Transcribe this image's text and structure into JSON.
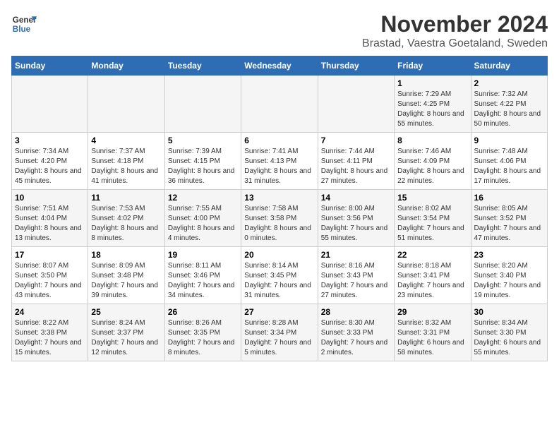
{
  "header": {
    "logo_general": "General",
    "logo_blue": "Blue",
    "month_title": "November 2024",
    "location": "Brastad, Vaestra Goetaland, Sweden"
  },
  "weekdays": [
    "Sunday",
    "Monday",
    "Tuesday",
    "Wednesday",
    "Thursday",
    "Friday",
    "Saturday"
  ],
  "weeks": [
    [
      {
        "day": "",
        "info": ""
      },
      {
        "day": "",
        "info": ""
      },
      {
        "day": "",
        "info": ""
      },
      {
        "day": "",
        "info": ""
      },
      {
        "day": "",
        "info": ""
      },
      {
        "day": "1",
        "info": "Sunrise: 7:29 AM\nSunset: 4:25 PM\nDaylight: 8 hours and 55 minutes."
      },
      {
        "day": "2",
        "info": "Sunrise: 7:32 AM\nSunset: 4:22 PM\nDaylight: 8 hours and 50 minutes."
      }
    ],
    [
      {
        "day": "3",
        "info": "Sunrise: 7:34 AM\nSunset: 4:20 PM\nDaylight: 8 hours and 45 minutes."
      },
      {
        "day": "4",
        "info": "Sunrise: 7:37 AM\nSunset: 4:18 PM\nDaylight: 8 hours and 41 minutes."
      },
      {
        "day": "5",
        "info": "Sunrise: 7:39 AM\nSunset: 4:15 PM\nDaylight: 8 hours and 36 minutes."
      },
      {
        "day": "6",
        "info": "Sunrise: 7:41 AM\nSunset: 4:13 PM\nDaylight: 8 hours and 31 minutes."
      },
      {
        "day": "7",
        "info": "Sunrise: 7:44 AM\nSunset: 4:11 PM\nDaylight: 8 hours and 27 minutes."
      },
      {
        "day": "8",
        "info": "Sunrise: 7:46 AM\nSunset: 4:09 PM\nDaylight: 8 hours and 22 minutes."
      },
      {
        "day": "9",
        "info": "Sunrise: 7:48 AM\nSunset: 4:06 PM\nDaylight: 8 hours and 17 minutes."
      }
    ],
    [
      {
        "day": "10",
        "info": "Sunrise: 7:51 AM\nSunset: 4:04 PM\nDaylight: 8 hours and 13 minutes."
      },
      {
        "day": "11",
        "info": "Sunrise: 7:53 AM\nSunset: 4:02 PM\nDaylight: 8 hours and 8 minutes."
      },
      {
        "day": "12",
        "info": "Sunrise: 7:55 AM\nSunset: 4:00 PM\nDaylight: 8 hours and 4 minutes."
      },
      {
        "day": "13",
        "info": "Sunrise: 7:58 AM\nSunset: 3:58 PM\nDaylight: 8 hours and 0 minutes."
      },
      {
        "day": "14",
        "info": "Sunrise: 8:00 AM\nSunset: 3:56 PM\nDaylight: 7 hours and 55 minutes."
      },
      {
        "day": "15",
        "info": "Sunrise: 8:02 AM\nSunset: 3:54 PM\nDaylight: 7 hours and 51 minutes."
      },
      {
        "day": "16",
        "info": "Sunrise: 8:05 AM\nSunset: 3:52 PM\nDaylight: 7 hours and 47 minutes."
      }
    ],
    [
      {
        "day": "17",
        "info": "Sunrise: 8:07 AM\nSunset: 3:50 PM\nDaylight: 7 hours and 43 minutes."
      },
      {
        "day": "18",
        "info": "Sunrise: 8:09 AM\nSunset: 3:48 PM\nDaylight: 7 hours and 39 minutes."
      },
      {
        "day": "19",
        "info": "Sunrise: 8:11 AM\nSunset: 3:46 PM\nDaylight: 7 hours and 34 minutes."
      },
      {
        "day": "20",
        "info": "Sunrise: 8:14 AM\nSunset: 3:45 PM\nDaylight: 7 hours and 31 minutes."
      },
      {
        "day": "21",
        "info": "Sunrise: 8:16 AM\nSunset: 3:43 PM\nDaylight: 7 hours and 27 minutes."
      },
      {
        "day": "22",
        "info": "Sunrise: 8:18 AM\nSunset: 3:41 PM\nDaylight: 7 hours and 23 minutes."
      },
      {
        "day": "23",
        "info": "Sunrise: 8:20 AM\nSunset: 3:40 PM\nDaylight: 7 hours and 19 minutes."
      }
    ],
    [
      {
        "day": "24",
        "info": "Sunrise: 8:22 AM\nSunset: 3:38 PM\nDaylight: 7 hours and 15 minutes."
      },
      {
        "day": "25",
        "info": "Sunrise: 8:24 AM\nSunset: 3:37 PM\nDaylight: 7 hours and 12 minutes."
      },
      {
        "day": "26",
        "info": "Sunrise: 8:26 AM\nSunset: 3:35 PM\nDaylight: 7 hours and 8 minutes."
      },
      {
        "day": "27",
        "info": "Sunrise: 8:28 AM\nSunset: 3:34 PM\nDaylight: 7 hours and 5 minutes."
      },
      {
        "day": "28",
        "info": "Sunrise: 8:30 AM\nSunset: 3:33 PM\nDaylight: 7 hours and 2 minutes."
      },
      {
        "day": "29",
        "info": "Sunrise: 8:32 AM\nSunset: 3:31 PM\nDaylight: 6 hours and 58 minutes."
      },
      {
        "day": "30",
        "info": "Sunrise: 8:34 AM\nSunset: 3:30 PM\nDaylight: 6 hours and 55 minutes."
      }
    ]
  ]
}
